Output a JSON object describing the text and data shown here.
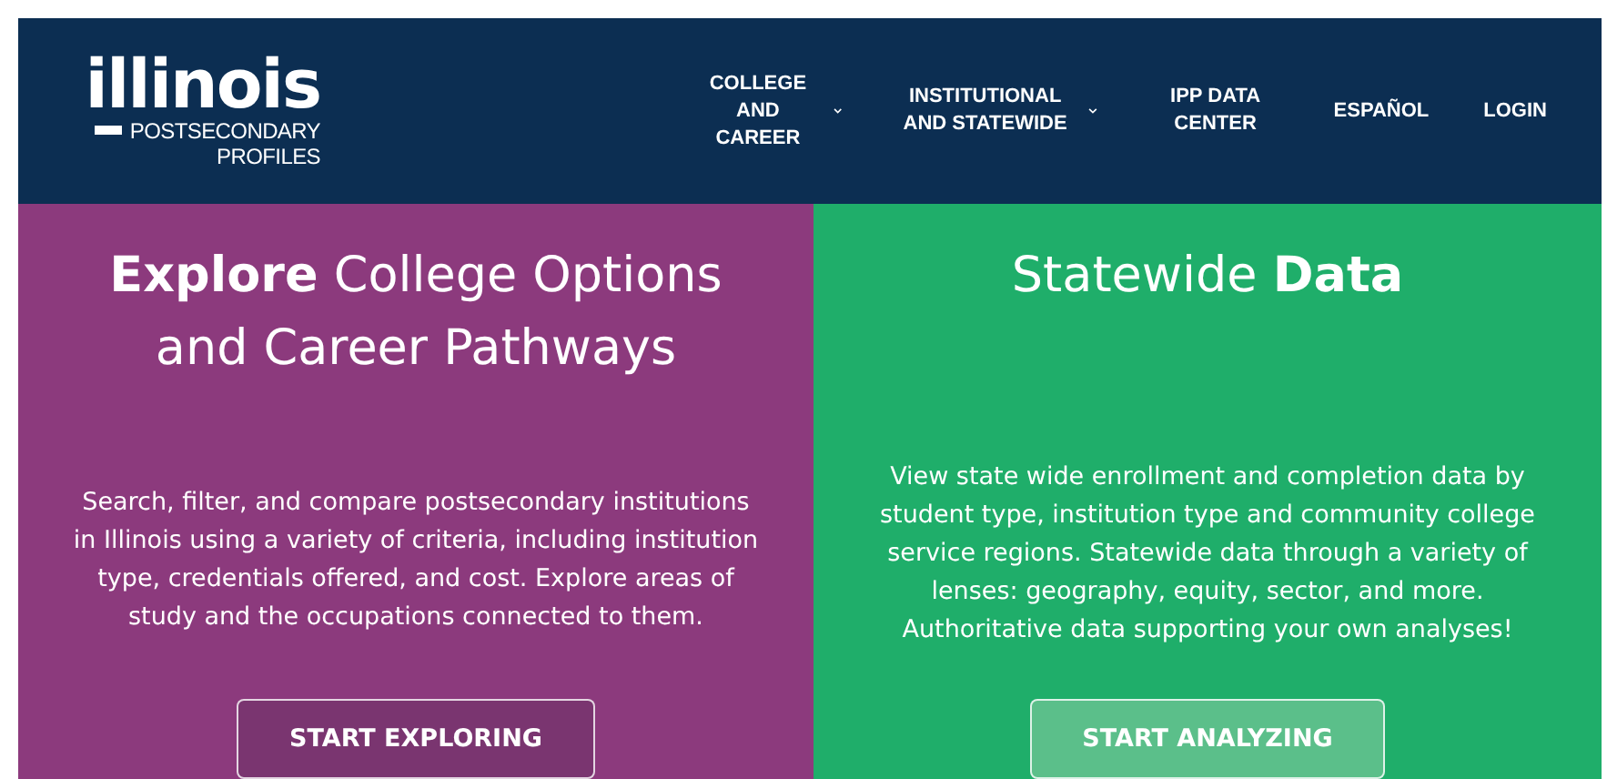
{
  "logo": {
    "wordmark": "illinois",
    "line_1": "POSTSECONDARY",
    "line_2": "PROFILES"
  },
  "nav": [
    {
      "label": "COLLEGE AND CAREER",
      "kind": "dropdown"
    },
    {
      "label": "INSTITUTIONAL AND STATEWIDE",
      "kind": "dropdown"
    },
    {
      "label": "IPP DATA CENTER",
      "kind": "link"
    },
    {
      "label": "ESPAÑOL",
      "kind": "link"
    },
    {
      "label": "LOGIN",
      "kind": "link"
    }
  ],
  "panels": [
    {
      "heading": "**Explore** College Options and Career Pathways",
      "text": "Search, filter, and compare postsecondary institutions in Illinois using a variety of criteria, including institution type, credentials offered, and cost. Explore areas of study and the occupations connected to them.",
      "button": "START EXPLORING",
      "color": "#8c3a7d"
    },
    {
      "heading": "Statewide **Data**",
      "text": "View state wide enrollment and completion data by student type, institution type and community college service regions. Statewide data through a variety of lenses: geography, equity, sector, and more.  Authoritative data supporting your own analyses!",
      "button": "START ANALYZING",
      "color": "#1fae6a"
    }
  ]
}
